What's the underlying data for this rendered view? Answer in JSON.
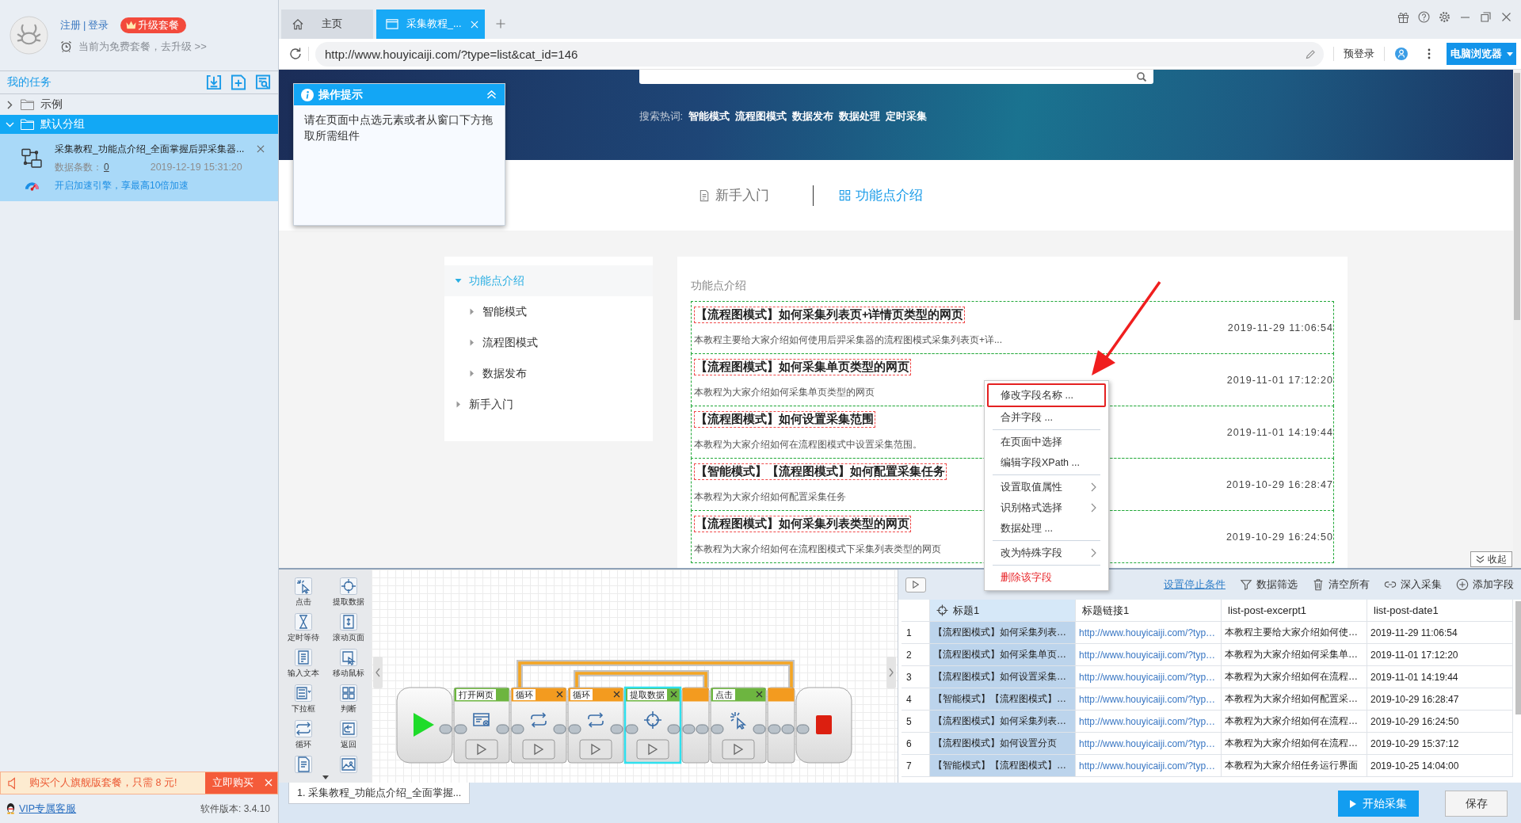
{
  "sidebar": {
    "account": {
      "register": "注册",
      "separator": "|",
      "login": "登录",
      "upgrade": "升级套餐",
      "plan_note": "当前为免费套餐，去升级 >>"
    },
    "tasks_title": "我的任务",
    "groups": [
      {
        "name": "示例",
        "expanded": false,
        "selected": false
      },
      {
        "name": "默认分组",
        "expanded": true,
        "selected": true,
        "tasks": [
          {
            "title": "采集教程_功能点介绍_全面掌握后羿采集器...",
            "count_label": "数据条数：",
            "count": "0",
            "time": "2019-12-19 15:31:20",
            "boost": "开启加速引擎，享最高10倍加速"
          }
        ]
      }
    ],
    "promo": {
      "text": "购买个人旗舰版套餐，只需 8 元!",
      "button": "立即购买"
    },
    "support": "VIP专属客服",
    "version": "软件版本: 3.4.10"
  },
  "tabs": [
    {
      "kind": "home",
      "label": "主页",
      "selected": false
    },
    {
      "kind": "page",
      "label": "采集教程_...",
      "selected": true
    }
  ],
  "address_bar": {
    "url": "http://www.houyicaiji.com/?type=list&cat_id=146",
    "login": "预登录",
    "browser_mode": "电脑浏览器"
  },
  "tip_panel": {
    "title": "操作提示",
    "body": "请在页面中点选元素或者从窗口下方拖取所需组件",
    "expanded": true
  },
  "webpage": {
    "hot_label": "搜索热词:",
    "hot_words": [
      "智能模式",
      "流程图模式",
      "数据发布",
      "数据处理",
      "定时采集"
    ],
    "nav": [
      {
        "kind": "guide",
        "label": "新手入门",
        "selected": false
      },
      {
        "kind": "features",
        "label": "功能点介绍",
        "selected": true
      }
    ],
    "categories": [
      {
        "label": "功能点介绍",
        "expanded": true,
        "selected": true,
        "children": [
          {
            "label": "智能模式",
            "expanded": false,
            "selected": false
          },
          {
            "label": "流程图模式",
            "expanded": false,
            "selected": false
          },
          {
            "label": "数据发布",
            "expanded": false,
            "selected": false
          }
        ]
      },
      {
        "label": "新手入门",
        "expanded": false,
        "selected": false
      }
    ],
    "list_title": "功能点介绍",
    "articles": [
      {
        "title": "【流程图模式】如何采集列表页+详情页类型的网页",
        "excerpt": "本教程主要给大家介绍如何使用后羿采集器的流程图模式采集列表页+详...",
        "date": "2019-11-29 11:06:54"
      },
      {
        "title": "【流程图模式】如何采集单页类型的网页",
        "excerpt": "本教程为大家介绍如何采集单页类型的网页",
        "date": "2019-11-01 17:12:20"
      },
      {
        "title": "【流程图模式】如何设置采集范围",
        "excerpt": "本教程为大家介绍如何在流程图模式中设置采集范围。",
        "date": "2019-11-01 14:19:44"
      },
      {
        "title": "【智能模式】【流程图模式】如何配置采集任务",
        "excerpt": "本教程为大家介绍如何配置采集任务",
        "date": "2019-10-29 16:28:47"
      },
      {
        "title": "【流程图模式】如何采集列表类型的网页",
        "excerpt": "本教程为大家介绍如何在流程图模式下采集列表类型的网页",
        "date": "2019-10-29 16:24:50"
      }
    ],
    "collapse_button": "收起"
  },
  "context_menu": {
    "sections": [
      {
        "items": [
          {
            "label": "修改字段名称 ...",
            "submenu": false,
            "danger": false,
            "annotated": true
          },
          {
            "label": "合并字段 ...",
            "submenu": false,
            "danger": false,
            "annotated": false
          }
        ]
      },
      {
        "items": [
          {
            "label": "在页面中选择",
            "submenu": false,
            "danger": false,
            "annotated": false
          },
          {
            "label": "编辑字段XPath ...",
            "submenu": false,
            "danger": false,
            "annotated": false
          }
        ]
      },
      {
        "items": [
          {
            "label": "设置取值属性",
            "submenu": true,
            "danger": false,
            "annotated": false
          },
          {
            "label": "识别格式选择",
            "submenu": true,
            "danger": false,
            "annotated": false
          },
          {
            "label": "数据处理 ...",
            "submenu": false,
            "danger": false,
            "annotated": false
          }
        ]
      },
      {
        "items": [
          {
            "label": "改为特殊字段",
            "submenu": true,
            "danger": false,
            "annotated": false
          }
        ]
      },
      {
        "items": [
          {
            "label": "删除该字段",
            "submenu": false,
            "danger": true,
            "annotated": false
          }
        ]
      }
    ]
  },
  "workflow": {
    "tools": [
      {
        "kind": "click",
        "label": "点击"
      },
      {
        "kind": "extract",
        "label": "提取数据"
      },
      {
        "kind": "wait",
        "label": "定时等待"
      },
      {
        "kind": "scroll",
        "label": "滚动页面"
      },
      {
        "kind": "input",
        "label": "输入文本"
      },
      {
        "kind": "mouse",
        "label": "移动鼠标"
      },
      {
        "kind": "dropdown",
        "label": "下拉框"
      },
      {
        "kind": "condition",
        "label": "判断"
      },
      {
        "kind": "loop",
        "label": "循环"
      },
      {
        "kind": "back",
        "label": "返回"
      },
      {
        "kind": "page"
      },
      {
        "kind": "image"
      }
    ],
    "nodes": [
      {
        "kind": "start",
        "selected": false
      },
      {
        "kind": "open_page",
        "label": "打开网页",
        "selected": false
      },
      {
        "kind": "loop",
        "label": "循环",
        "selected": false
      },
      {
        "kind": "loop",
        "label": "循环",
        "selected": false
      },
      {
        "kind": "extract",
        "label": "提取数据",
        "selected": true
      },
      {
        "kind": "loop_end",
        "selected": false
      },
      {
        "kind": "click",
        "label": "点击",
        "selected": false
      },
      {
        "kind": "loop_end",
        "selected": false
      },
      {
        "kind": "stop",
        "selected": false
      }
    ],
    "tab": "1. 采集教程_功能点介绍_全面掌握..."
  },
  "data_panel": {
    "stop_condition": "设置停止条件",
    "actions": [
      {
        "kind": "filter",
        "label": "数据筛选"
      },
      {
        "kind": "clear",
        "label": "清空所有"
      },
      {
        "kind": "deep",
        "label": "深入采集"
      },
      {
        "kind": "add",
        "label": "添加字段"
      }
    ],
    "columns": [
      {
        "label": "标题1",
        "kind": "text",
        "selected": true
      },
      {
        "label": "标题链接1",
        "kind": "link",
        "selected": false
      },
      {
        "label": "list-post-excerpt1",
        "kind": "text",
        "selected": false
      },
      {
        "label": "list-post-date1",
        "kind": "text",
        "selected": false
      }
    ],
    "rows": [
      {
        "number": "1",
        "cells": [
          "【流程图模式】如何采集列表…",
          "http://www.houyicaiji.com/?typ…",
          "本教程主要给大家介绍如何使…",
          "2019-11-29 11:06:54"
        ]
      },
      {
        "number": "2",
        "cells": [
          "【流程图模式】如何采集单页…",
          "http://www.houyicaiji.com/?typ…",
          "本教程为大家介绍如何采集单…",
          "2019-11-01 17:12:20"
        ]
      },
      {
        "number": "3",
        "cells": [
          "【流程图模式】如何设置采集…",
          "http://www.houyicaiji.com/?typ…",
          "本教程为大家介绍如何在流程…",
          "2019-11-01 14:19:44"
        ]
      },
      {
        "number": "4",
        "cells": [
          "【智能模式】【流程图模式】…",
          "http://www.houyicaiji.com/?typ…",
          "本教程为大家介绍如何配置采…",
          "2019-10-29 16:28:47"
        ]
      },
      {
        "number": "5",
        "cells": [
          "【流程图模式】如何采集列表…",
          "http://www.houyicaiji.com/?typ…",
          "本教程为大家介绍如何在流程…",
          "2019-10-29 16:24:50"
        ]
      },
      {
        "number": "6",
        "cells": [
          "【流程图模式】如何设置分页",
          "http://www.houyicaiji.com/?typ…",
          "本教程为大家介绍如何在流程…",
          "2019-10-29 15:37:12"
        ]
      },
      {
        "number": "7",
        "cells": [
          "【智能模式】【流程图模式】…",
          "http://www.houyicaiji.com/?typ…",
          "本教程为大家介绍任务运行界面",
          "2019-10-25 14:04:00"
        ]
      }
    ]
  },
  "footer": {
    "start": "开始采集",
    "save": "保存"
  }
}
